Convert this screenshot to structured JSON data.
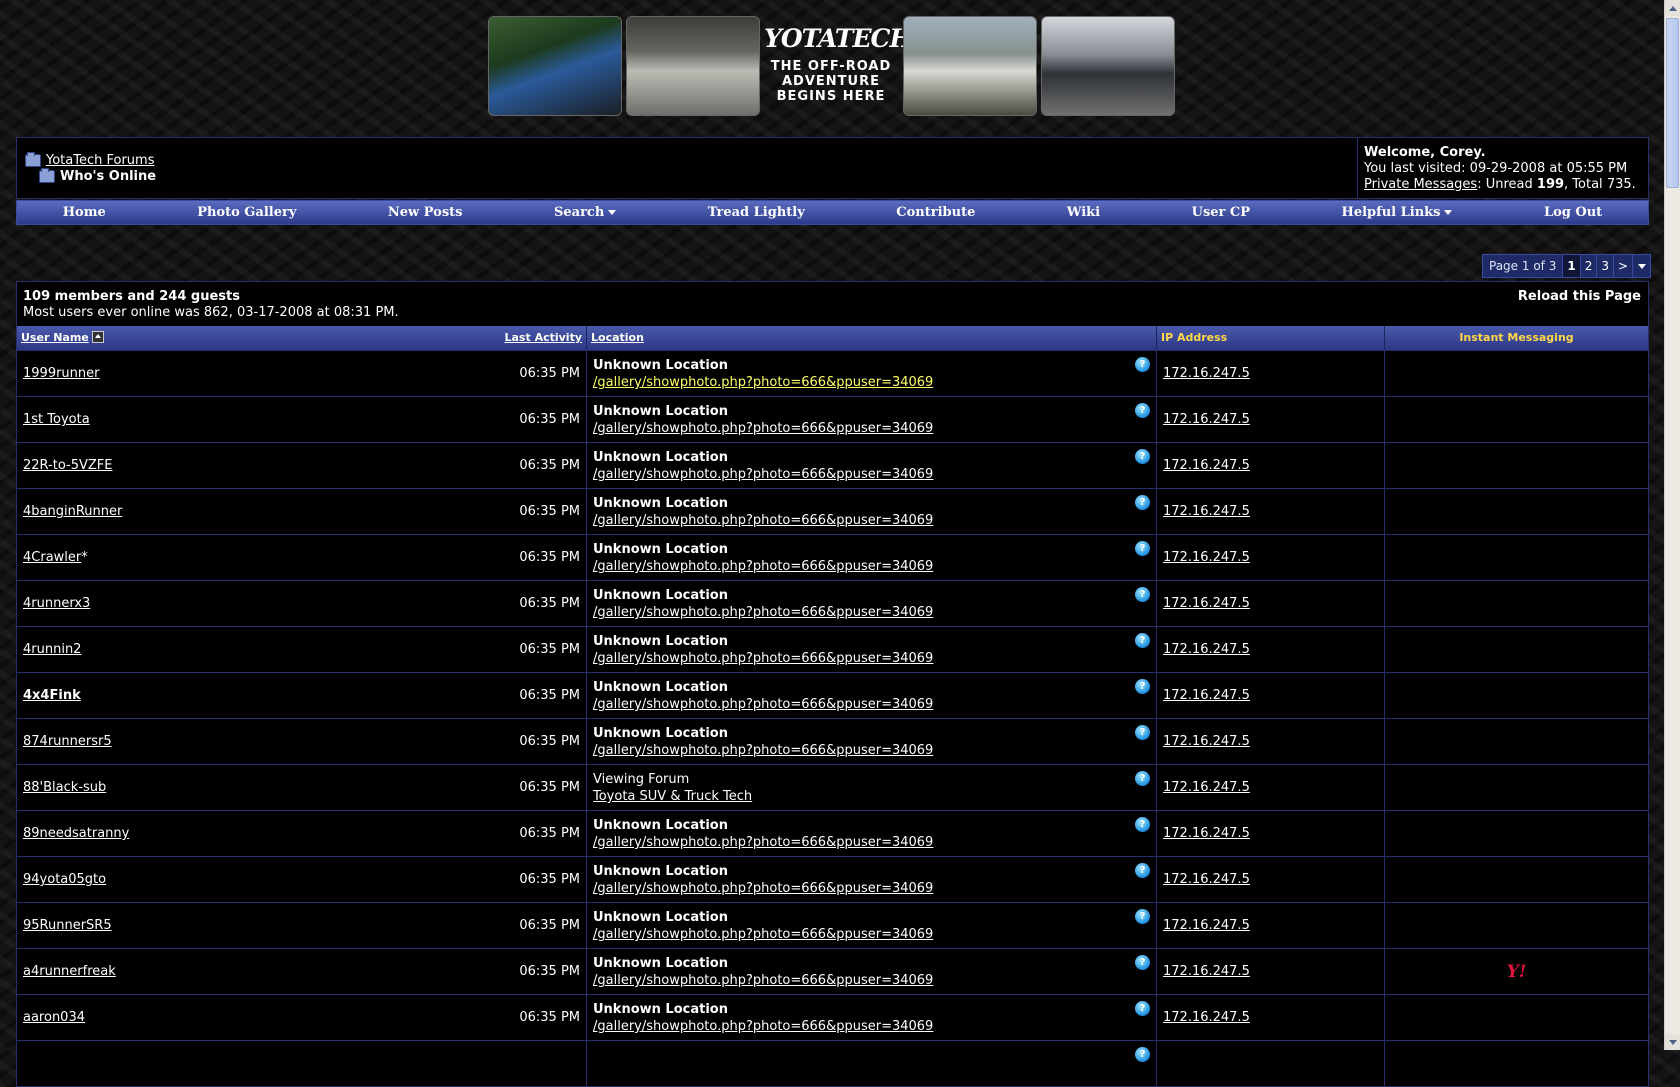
{
  "banner": {
    "logo_title": "YOTATECH",
    "tagline_lines": [
      "THE OFF-ROAD",
      "ADVENTURE",
      "BEGINS HERE"
    ]
  },
  "breadcrumb": {
    "root": "YotaTech Forums",
    "current": "Who's Online"
  },
  "welcome": {
    "greeting": "Welcome, Corey.",
    "last_visited_prefix": "You last visited: ",
    "last_visited_date": "09-29-2008",
    "last_visited_at": " at ",
    "last_visited_time": "05:55 PM",
    "pm_link": "Private Messages",
    "pm_unread_label": ": Unread ",
    "pm_unread": "199",
    "pm_total_label": ", Total ",
    "pm_total": "735",
    "pm_end": "."
  },
  "nav": {
    "items": [
      "Home",
      "Photo Gallery",
      "New Posts",
      "Search",
      "Tread Lightly",
      "Contribute",
      "Wiki",
      "User CP",
      "Helpful Links",
      "Log Out"
    ]
  },
  "pager": {
    "label": "Page 1 of 3",
    "pages": [
      "1",
      "2",
      "3"
    ],
    "next": ">"
  },
  "online": {
    "summary": "109 members and 244 guests",
    "record": "Most users ever online was 862, 03-17-2008 at 08:31 PM.",
    "reload": "Reload this Page"
  },
  "table": {
    "headers": {
      "username": "User Name",
      "last_activity": "Last Activity",
      "location": "Location",
      "ip": "IP Address",
      "im": "Instant Messaging"
    },
    "rows": [
      {
        "user": "1999runner",
        "time": "06:35 PM",
        "loc_title": "Unknown Location",
        "loc_url": "/gallery/showphoto.php?photo=666&ppuser=34069",
        "ip": "172.16.247.5"
      },
      {
        "user": "1st Toyota",
        "time": "06:35 PM",
        "loc_title": "Unknown Location",
        "loc_url": "/gallery/showphoto.php?photo=666&ppuser=34069",
        "ip": "172.16.247.5"
      },
      {
        "user": "22R-to-5VZFE",
        "time": "06:35 PM",
        "loc_title": "Unknown Location",
        "loc_url": "/gallery/showphoto.php?photo=666&ppuser=34069",
        "ip": "172.16.247.5"
      },
      {
        "user": "4banginRunner",
        "time": "06:35 PM",
        "loc_title": "Unknown Location",
        "loc_url": "/gallery/showphoto.php?photo=666&ppuser=34069",
        "ip": "172.16.247.5"
      },
      {
        "user": "4Crawler",
        "suffix": "*",
        "time": "06:35 PM",
        "loc_title": "Unknown Location",
        "loc_url": "/gallery/showphoto.php?photo=666&ppuser=34069",
        "ip": "172.16.247.5"
      },
      {
        "user": "4runnerx3",
        "time": "06:35 PM",
        "loc_title": "Unknown Location",
        "loc_url": "/gallery/showphoto.php?photo=666&ppuser=34069",
        "ip": "172.16.247.5"
      },
      {
        "user": "4runnin2",
        "time": "06:35 PM",
        "loc_title": "Unknown Location",
        "loc_url": "/gallery/showphoto.php?photo=666&ppuser=34069",
        "ip": "172.16.247.5"
      },
      {
        "user": "4x4Fink",
        "user_bold": true,
        "time": "06:35 PM",
        "loc_title": "Unknown Location",
        "loc_url": "/gallery/showphoto.php?photo=666&ppuser=34069",
        "ip": "172.16.247.5"
      },
      {
        "user": "874runnersr5",
        "time": "06:35 PM",
        "loc_title": "Unknown Location",
        "loc_url": "/gallery/showphoto.php?photo=666&ppuser=34069",
        "ip": "172.16.247.5"
      },
      {
        "user": "88'Black-sub",
        "time": "06:35 PM",
        "loc_title": "Viewing Forum",
        "loc_title_plain": true,
        "loc_url": "Toyota SUV & Truck Tech",
        "ip": "172.16.247.5"
      },
      {
        "user": "89needsatranny",
        "time": "06:35 PM",
        "loc_title": "Unknown Location",
        "loc_url": "/gallery/showphoto.php?photo=666&ppuser=34069",
        "ip": "172.16.247.5"
      },
      {
        "user": "94yota05gto",
        "time": "06:35 PM",
        "loc_title": "Unknown Location",
        "loc_url": "/gallery/showphoto.php?photo=666&ppuser=34069",
        "ip": "172.16.247.5"
      },
      {
        "user": "95RunnerSR5",
        "time": "06:35 PM",
        "loc_title": "Unknown Location",
        "loc_url": "/gallery/showphoto.php?photo=666&ppuser=34069",
        "ip": "172.16.247.5"
      },
      {
        "user": "a4runnerfreak",
        "time": "06:35 PM",
        "loc_title": "Unknown Location",
        "loc_url": "/gallery/showphoto.php?photo=666&ppuser=34069",
        "ip": "172.16.247.5",
        "im": "Y!"
      },
      {
        "user": "aaron034",
        "time": "06:35 PM",
        "loc_title": "Unknown Location",
        "loc_url": "/gallery/showphoto.php?photo=666&ppuser=34069",
        "ip": "172.16.247.5"
      },
      {
        "user": "",
        "time": "",
        "loc_title": "",
        "loc_url": "",
        "ip": ""
      }
    ]
  },
  "colors": {
    "link_highlight": "#ffff66",
    "header_yellow": "#ffd84a",
    "nav_blue": "#3b4aa0",
    "yahoo_red": "#e0143c",
    "help_icon": "#1d8fe0"
  }
}
